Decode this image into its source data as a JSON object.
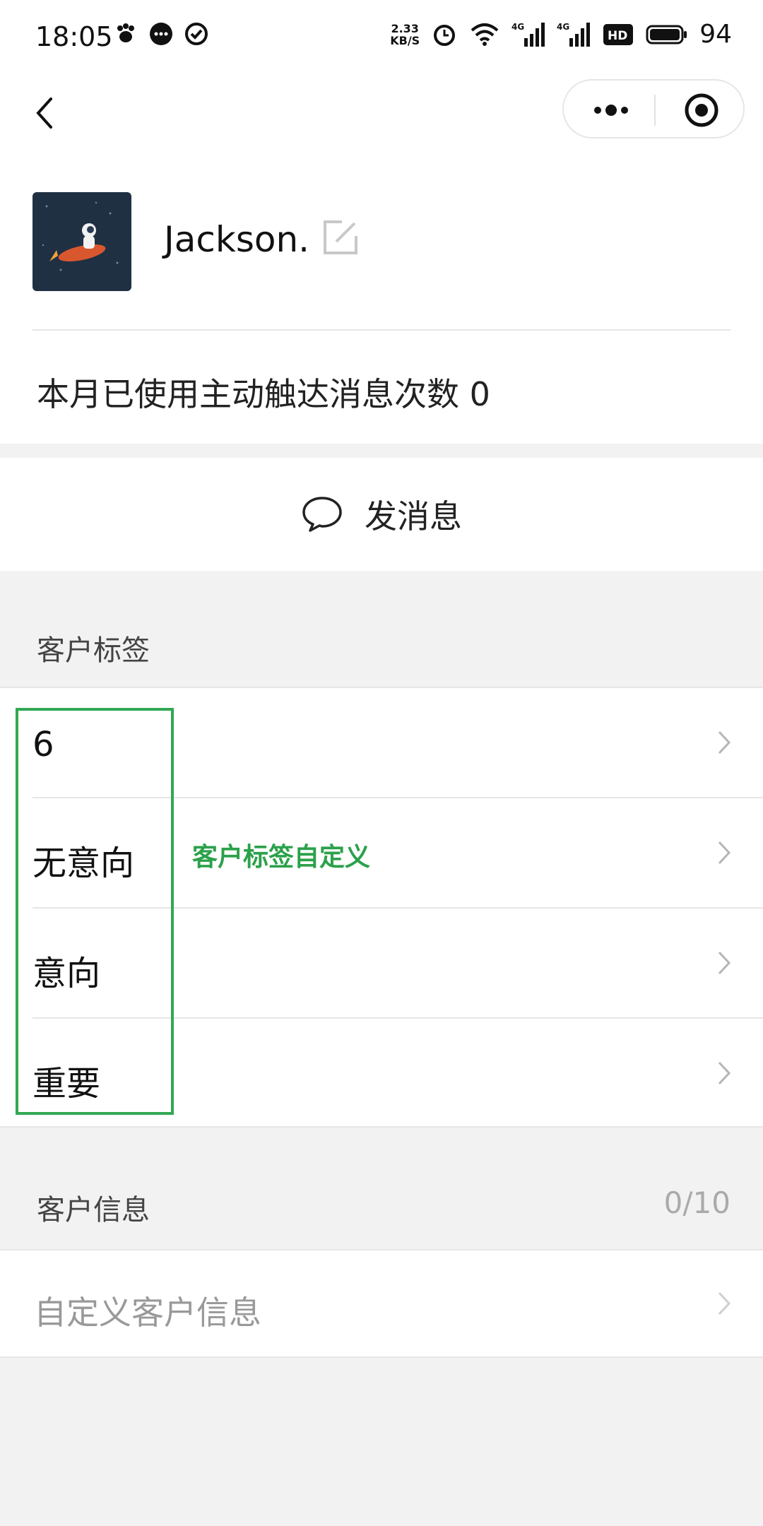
{
  "status_bar": {
    "time": "18:05",
    "left_icons": [
      "paw-icon",
      "chat-bubble-icon",
      "check-circle-icon"
    ],
    "net_speed_value": "2.33",
    "net_speed_unit": "KB/S",
    "right_icons": [
      "alarm-icon",
      "wifi-icon",
      "signal-4g-icon",
      "signal-4g-icon",
      "hd-icon",
      "battery-icon"
    ],
    "signal_label": "4G",
    "hd_label": "HD",
    "battery": "94"
  },
  "nav": {
    "back_icon": "chevron-left-icon",
    "more_icon": "more-dots-icon",
    "close_icon": "target-icon"
  },
  "profile": {
    "name": "Jackson.",
    "edit_icon": "edit-icon",
    "usage_text": "本月已使用主动触达消息次数 0"
  },
  "send_message": {
    "icon": "speech-bubble-icon",
    "label": "发消息"
  },
  "tags_section": {
    "title": "客户标签",
    "items": [
      "6",
      "无意向",
      "意向",
      "重要"
    ],
    "annotation": "客户标签自定义"
  },
  "info_section": {
    "title": "客户信息",
    "count": "0/10",
    "placeholder": "自定义客户信息"
  },
  "colors": {
    "highlight": "#32a853",
    "annotation": "#2ba14a",
    "background": "#f2f2f2"
  }
}
